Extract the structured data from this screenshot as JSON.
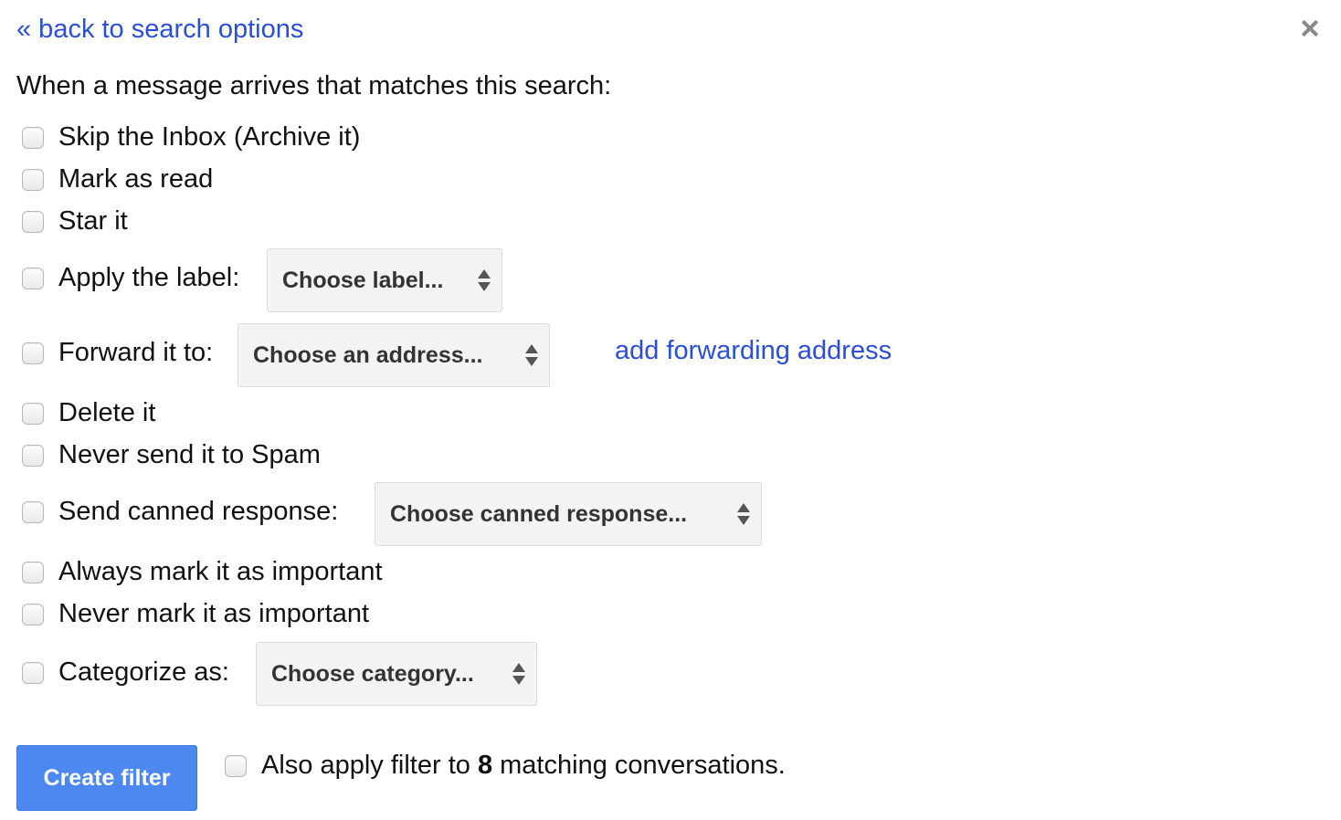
{
  "header": {
    "back_link": "« back to search options",
    "close_icon": "close-icon"
  },
  "intro": "When a message arrives that matches this search:",
  "actions": [
    {
      "label": "Skip the Inbox (Archive it)",
      "checked": false
    },
    {
      "label": "Mark as read",
      "checked": false
    },
    {
      "label": "Star it",
      "checked": false
    },
    {
      "label": "Apply the label:",
      "checked": false,
      "select": "Choose label..."
    },
    {
      "label": "Forward it to:",
      "checked": false,
      "select": "Choose an address...",
      "link": "add forwarding address"
    },
    {
      "label": "Delete it",
      "checked": false
    },
    {
      "label": "Never send it to Spam",
      "checked": false
    },
    {
      "label": "Send canned response:",
      "checked": false,
      "select": "Choose canned response..."
    },
    {
      "label": "Always mark it as important",
      "checked": false
    },
    {
      "label": "Never mark it as important",
      "checked": false
    },
    {
      "label": "Categorize as:",
      "checked": false,
      "select": "Choose category..."
    }
  ],
  "footer": {
    "create_button": "Create filter",
    "also_apply_prefix": "Also apply filter to ",
    "matching_count": "8",
    "also_apply_suffix": " matching conversations.",
    "also_apply_checked": false
  },
  "colors": {
    "link": "#2a4fd6",
    "primary_button": "#4d87f0"
  }
}
